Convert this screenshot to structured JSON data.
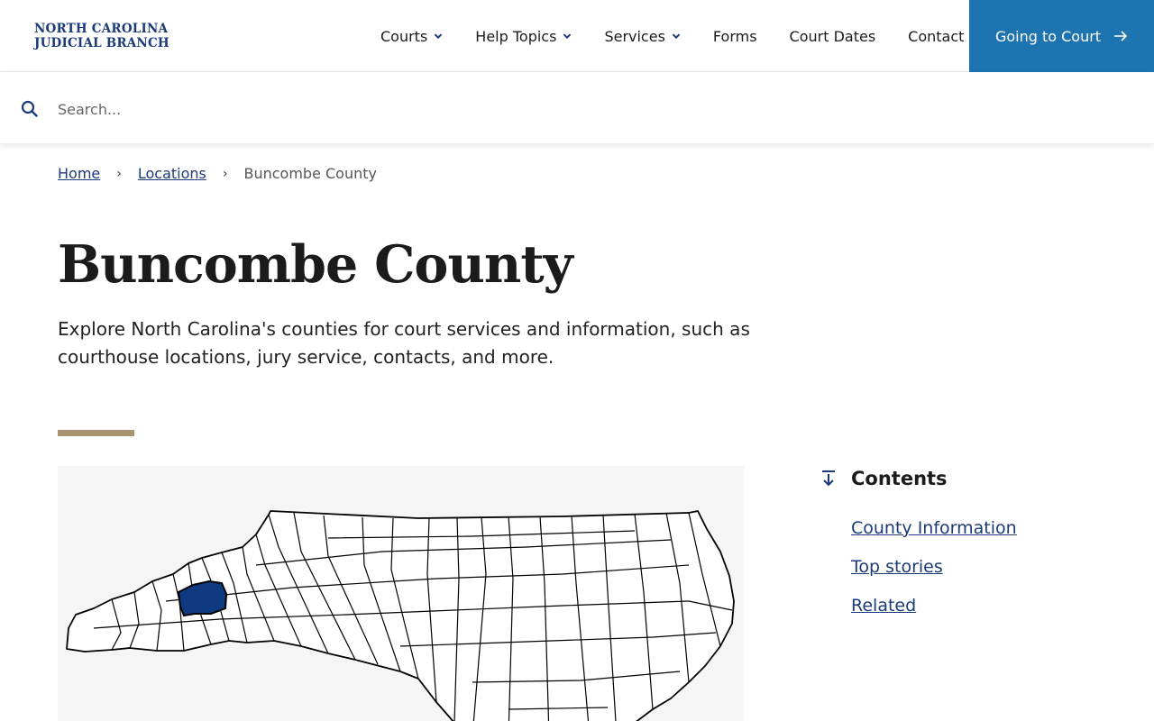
{
  "header": {
    "logo_line1": "NORTH CAROLINA",
    "logo_line2": "JUDICIAL BRANCH",
    "nav": [
      {
        "label": "Courts",
        "has_dropdown": true
      },
      {
        "label": "Help Topics",
        "has_dropdown": true
      },
      {
        "label": "Services",
        "has_dropdown": true
      },
      {
        "label": "Forms",
        "has_dropdown": false
      },
      {
        "label": "Court Dates",
        "has_dropdown": false
      },
      {
        "label": "Contact",
        "has_dropdown": false
      }
    ],
    "cta_label": "Going to Court",
    "cta_icon": "arrow-right-icon",
    "cta_color": "#1e73b1"
  },
  "search": {
    "placeholder": "Search...",
    "value": "",
    "icon": "search-icon"
  },
  "breadcrumb": {
    "items": [
      "Home",
      "Locations"
    ],
    "current": "Buncombe County"
  },
  "main": {
    "title": "Buncombe County",
    "intro": "Explore North Carolina's counties for court services and information, such as courthouse locations, jury service, contacts, and more.",
    "accent_color": "#a89470",
    "map_highlight_color": "#0f3a82"
  },
  "contents": {
    "title": "Contents",
    "icon": "arrow-down-to-line-icon",
    "links": [
      "County Information",
      "Top stories",
      "Related"
    ]
  }
}
